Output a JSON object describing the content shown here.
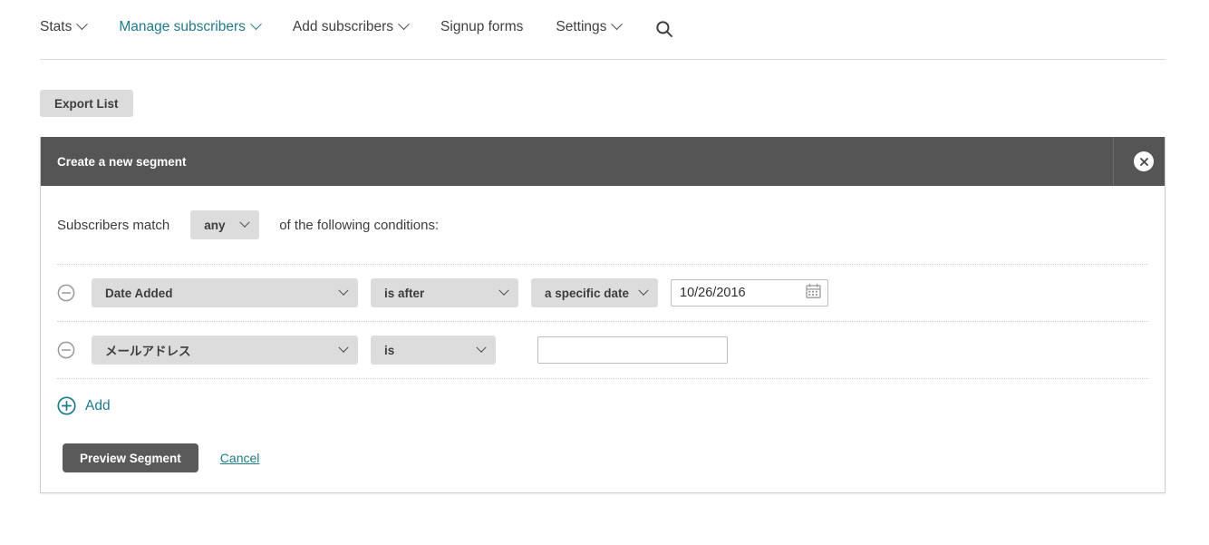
{
  "nav": {
    "items": [
      {
        "label": "Stats",
        "has_caret": true,
        "active": false
      },
      {
        "label": "Manage subscribers",
        "has_caret": true,
        "active": true
      },
      {
        "label": "Add subscribers",
        "has_caret": true,
        "active": false
      },
      {
        "label": "Signup forms",
        "has_caret": false,
        "active": false
      },
      {
        "label": "Settings",
        "has_caret": true,
        "active": false
      }
    ],
    "search_icon": "search-icon"
  },
  "toolbar": {
    "export_label": "Export List"
  },
  "panel": {
    "title": "Create a new segment",
    "close_icon": "close-icon",
    "match": {
      "prefix": "Subscribers match",
      "selected": "any",
      "suffix": "of the following conditions:"
    },
    "conditions": [
      {
        "remove_icon": "minus-circle-icon",
        "field": "Date Added",
        "operator": "is after",
        "date_type": "a specific date",
        "value": "10/26/2016",
        "value_type": "date",
        "calendar_icon": "calendar-icon"
      },
      {
        "remove_icon": "minus-circle-icon",
        "field": "メールアドレス",
        "operator": "is",
        "value": "",
        "value_placeholder": "",
        "value_type": "text"
      }
    ],
    "add": {
      "icon": "plus-circle-icon",
      "label": "Add"
    },
    "footer": {
      "preview_label": "Preview Segment",
      "cancel_label": "Cancel"
    }
  },
  "colors": {
    "accent_teal": "#1f7a8c",
    "panel_header": "#555555",
    "control_gray": "#dcdcdc",
    "primary_button": "#5a5a5a"
  }
}
